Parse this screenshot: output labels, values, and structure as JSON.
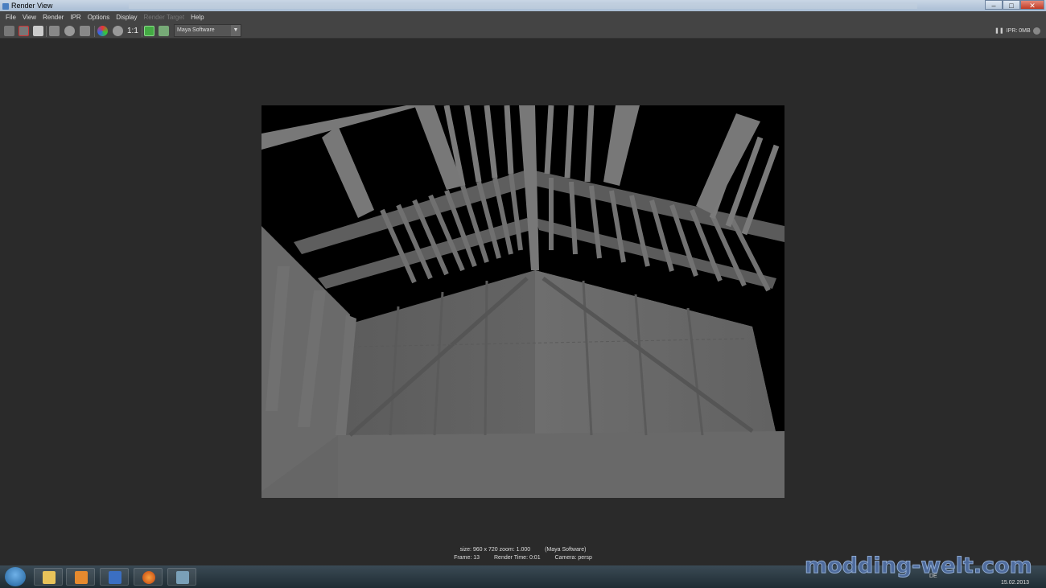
{
  "window": {
    "title": "Render View",
    "controls": {
      "minimize": "–",
      "maximize": "□",
      "close": "✕"
    }
  },
  "menu": [
    "File",
    "View",
    "Render",
    "IPR",
    "Options",
    "Display",
    "Render Target",
    "Help"
  ],
  "toolbar": {
    "ratio_label": "1:1",
    "renderer": "Maya Software",
    "ipr_status": "IPR: 0MB",
    "icons": [
      "redo-render-icon",
      "ipr-render-icon",
      "snapshot-icon",
      "render-region-icon",
      "refresh-icon",
      "keep-image-icon",
      "rgb-channel-icon",
      "alpha-channel-icon",
      "real-size-icon",
      "save-image-icon",
      "layer-icon"
    ]
  },
  "render_info": {
    "size": "size: 960 x 720 zoom: 1.000",
    "renderer": "(Maya Software)",
    "frame": "Frame: 13",
    "render_time": "Render Time: 0:01",
    "camera": "Camera: persp"
  },
  "taskbar": {
    "apps": [
      "explorer-icon",
      "media-player-icon",
      "paint-icon",
      "firefox-icon",
      "maya-icon"
    ],
    "lang": "DE",
    "date": "15.02.2013"
  },
  "watermark": "modding-welt.com",
  "colors": {
    "chrome": "#444444",
    "viewport": "#2a2a2a",
    "render_gray": "#6e6e6e",
    "titlebar": "#b9c9dc"
  }
}
